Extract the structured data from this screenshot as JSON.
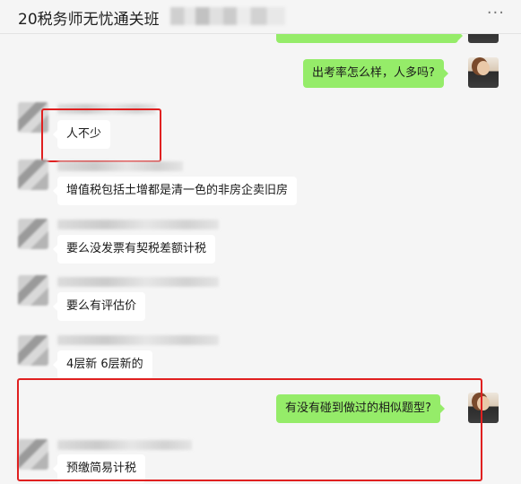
{
  "header": {
    "title": "20税务师无忧通关班",
    "more_icon": "···"
  },
  "messages": [
    {
      "side": "right",
      "text": ""
    },
    {
      "side": "right",
      "text": "出考率怎么样，人多吗?"
    },
    {
      "side": "left",
      "text": "人不少"
    },
    {
      "side": "left",
      "text": "增值税包括土增都是清一色的非房企卖旧房"
    },
    {
      "side": "left",
      "text": "要么没发票有契税差额计税"
    },
    {
      "side": "left",
      "text": "要么有评估价"
    },
    {
      "side": "left",
      "text": "4层新 6层新的"
    },
    {
      "side": "right",
      "text": "有没有碰到做过的相似题型?"
    },
    {
      "side": "left",
      "text": "预缴简易计税"
    }
  ],
  "colors": {
    "background": "#f5f5f5",
    "bubble_self": "#95ec69",
    "bubble_other": "#ffffff",
    "highlight": "#e02020"
  }
}
